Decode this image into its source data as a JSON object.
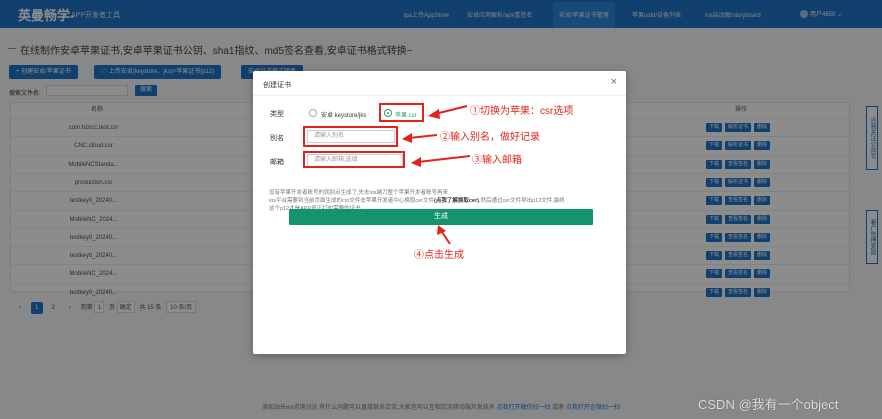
{
  "app": {
    "brand": "英曼畅学-",
    "brand_sub": "APP开发者工具",
    "nav": [
      "ipa上传AppStore",
      "安卓应用解析/apk重签名",
      "安卓/苹果证书管理",
      "苹果udid/设备列表",
      "ios启动图/storyboard"
    ],
    "user": "用户4650"
  },
  "page": {
    "title": "在线制作安卓苹果证书,安卓苹果证书公钥、sha1指纹、md5签名查看,安卓证书格式转换~",
    "btn_create": "创建安卓/苹果证书",
    "btn_upload": "上传安卓(keystore、jks)+苹果证书(p12)",
    "btn_third": "安卓证书格式转换",
    "search_label": "搜索文件名:",
    "search_btn": "搜索"
  },
  "table": {
    "col_name": "名称",
    "col_action": "操作",
    "rows": [
      {
        "name": "com.hzncc.test.csr",
        "actions": [
          "下载",
          "解析证书",
          "删除"
        ]
      },
      {
        "name": "CNC.cloud.csr",
        "actions": [
          "下载",
          "解析证书",
          "删除"
        ]
      },
      {
        "name": "MobileNCStanda...",
        "actions": [
          "下载",
          "查看签名",
          "删除"
        ]
      },
      {
        "name": "production.csr",
        "actions": [
          "下载",
          "解析证书",
          "删除"
        ]
      },
      {
        "name": "testkey0_20240...",
        "actions": [
          "下载",
          "查看签名",
          "删除"
        ]
      },
      {
        "name": "MobileNC_2024...",
        "actions": [
          "下载",
          "查看签名",
          "删除"
        ]
      },
      {
        "name": "testkey0_20240...",
        "actions": [
          "下载",
          "查看签名",
          "删除"
        ]
      },
      {
        "name": "testkey0_20240...",
        "actions": [
          "下载",
          "查看签名",
          "删除"
        ]
      },
      {
        "name": "MobileNC_2024...",
        "actions": [
          "下载",
          "查看签名",
          "删除"
        ]
      },
      {
        "name": "testkey0_20240...",
        "actions": [
          "下载",
          "查看签名",
          "删除"
        ]
      }
    ]
  },
  "pager": {
    "pages": [
      "1",
      "2"
    ],
    "goto": "到第",
    "page_input": "1",
    "page_unit": "页",
    "confirm": "确定",
    "total": "共 15 条",
    "per_page": "10 条/页"
  },
  "side_tabs": [
    "点我关注公众号",
    "看广告得奖励"
  ],
  "footer": {
    "text": "添加站长wx咨询讨论,有什么问题可以直接联系交流,大家也可以互相交流移动端开发技术",
    "link1": "点我打开微信扫一扫",
    "sep": "或者",
    "link2": "点我打开企微扫一扫"
  },
  "watermark": "CSDN @我有一个object",
  "modal": {
    "title": "创建证书",
    "close": "×",
    "type_label": "类型",
    "type_opt1": "安卓 keystore/jks",
    "type_opt2": "苹果 csr",
    "alias_label": "别名",
    "alias_placeholder": "请输入别名",
    "email_label": "邮箱",
    "email_placeholder": "请输入邮箱,选填",
    "desc_line1": "没有苹果开发者账号的就别点生成了,先去ios端刀整个苹果开发者账号再来",
    "desc_line2_a": "ios平台需要到当前页面生成的csr文件去苹果开发者中心换取cer文件",
    "desc_line2_b": "(点我了解换取cer)",
    "desc_line2_c": ",然后通过cer文件导出p12文件,最终",
    "desc_line3": "这个p12才是APP真正打包需要的证书",
    "generate": "生成"
  },
  "annotations": {
    "a1": "①切换为苹果：csr选项",
    "a2": "②输入别名，做好记录",
    "a3": "③输入邮箱",
    "a4": "④点击生成"
  }
}
